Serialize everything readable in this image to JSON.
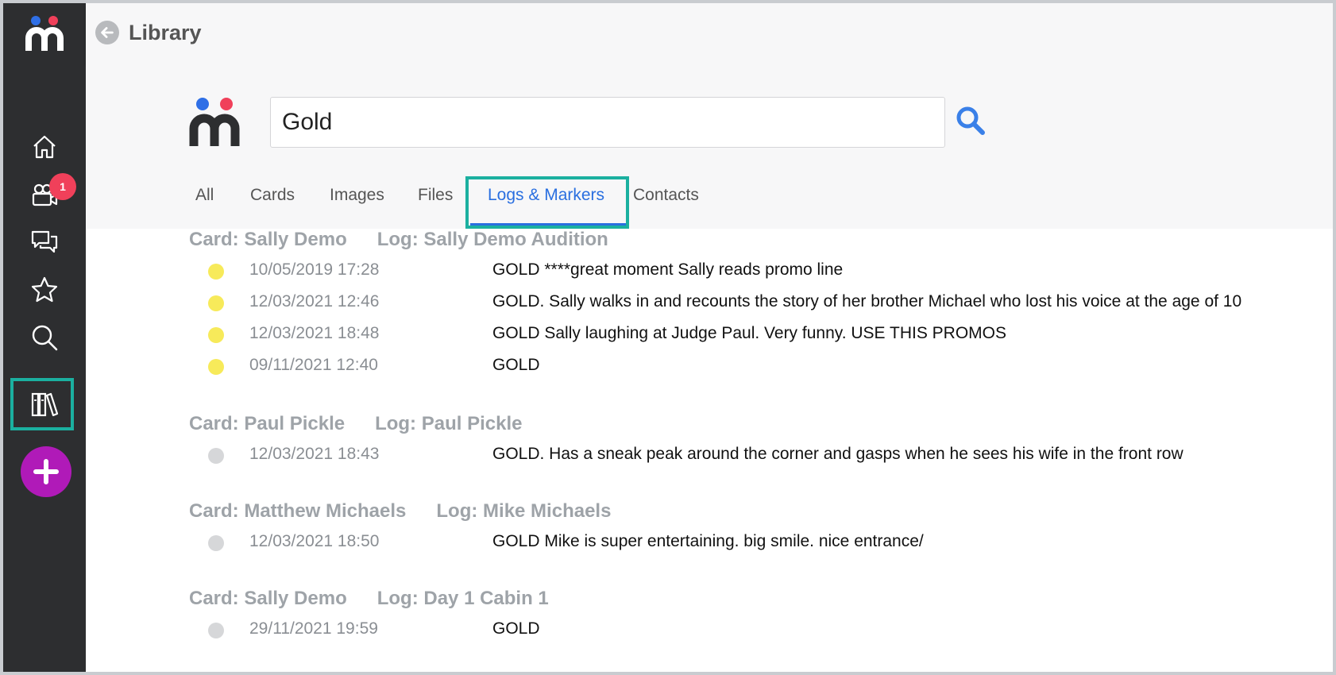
{
  "header": {
    "title": "Library"
  },
  "sidebar": {
    "nav": [
      {
        "id": "home",
        "icon": "home-icon"
      },
      {
        "id": "productions",
        "icon": "camera-icon",
        "badge": "1"
      },
      {
        "id": "messages",
        "icon": "chat-icon"
      },
      {
        "id": "favorites",
        "icon": "star-icon"
      },
      {
        "id": "search",
        "icon": "search-icon"
      },
      {
        "id": "library",
        "icon": "library-icon",
        "active": true
      }
    ],
    "add_icon": "plus-icon"
  },
  "search": {
    "value": "Gold"
  },
  "tabs": [
    {
      "label": "All"
    },
    {
      "label": "Cards"
    },
    {
      "label": "Images"
    },
    {
      "label": "Files"
    },
    {
      "label": "Logs & Markers",
      "active": true
    },
    {
      "label": "Contacts"
    }
  ],
  "colors": {
    "accent": "#2a6fe0",
    "highlight": "#1bb0a0",
    "add_button": "#b01ab8",
    "badge": "#f0405a",
    "gold_marker": "#f7ea5a",
    "grey_marker": "#d6d7d9"
  },
  "results": [
    {
      "card": "Card: Sally Demo",
      "log": "Log: Sally Demo Audition",
      "entries": [
        {
          "date": "10/05/2019 17:28",
          "text": "GOLD ****great moment Sally reads promo line",
          "marker": "yellow"
        },
        {
          "date": "12/03/2021 12:46",
          "text": "GOLD. Sally walks in and recounts the story of her brother Michael who lost his voice at the age of 10",
          "marker": "yellow"
        },
        {
          "date": "12/03/2021 18:48",
          "text": "GOLD Sally laughing at Judge Paul. Very funny. USE THIS PROMOS",
          "marker": "yellow"
        },
        {
          "date": "09/11/2021 12:40",
          "text": "GOLD",
          "marker": "yellow"
        }
      ]
    },
    {
      "card": "Card: Paul Pickle",
      "log": "Log: Paul Pickle",
      "entries": [
        {
          "date": "12/03/2021 18:43",
          "text": "GOLD. Has a sneak peak around the corner and gasps when he sees his wife in the front row",
          "marker": "grey"
        }
      ]
    },
    {
      "card": "Card: Matthew Michaels",
      "log": "Log: Mike Michaels",
      "entries": [
        {
          "date": "12/03/2021 18:50",
          "text": "GOLD Mike is super entertaining. big smile. nice entrance/",
          "marker": "grey"
        }
      ]
    },
    {
      "card": "Card: Sally Demo",
      "log": "Log: Day 1 Cabin 1",
      "entries": [
        {
          "date": "29/11/2021 19:59",
          "text": "GOLD",
          "marker": "grey"
        }
      ]
    }
  ]
}
